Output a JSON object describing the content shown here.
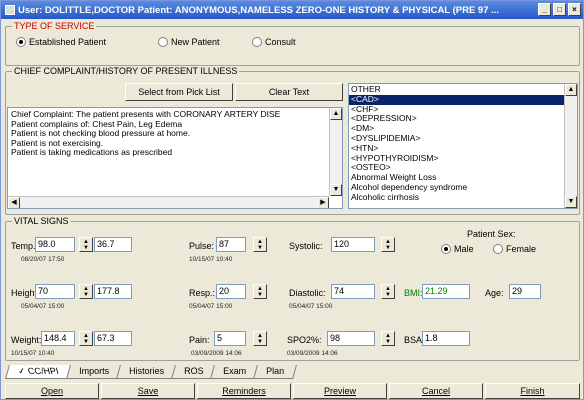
{
  "window": {
    "title": "User: DOLITTLE,DOCTOR Patient: ANONYMOUS,NAMELESS ZERO-ONE HISTORY & PHYSICAL (PRE 97 ..."
  },
  "service": {
    "group_title": "TYPE OF SERVICE",
    "options": [
      {
        "label": "Established Patient",
        "selected": true
      },
      {
        "label": "New Patient",
        "selected": false
      },
      {
        "label": "Consult",
        "selected": false
      }
    ]
  },
  "complaint": {
    "group_title": "CHIEF COMPLAINT/HISTORY OF PRESENT ILLNESS",
    "pick_button": "Select from Pick List",
    "clear_button": "Clear Text",
    "text_lines": [
      "Chief Complaint: The patient presents with CORONARY ARTERY DISE",
      "Patient complains of: Chest Pain, Leg Edema",
      "Patient is not checking blood pressure at home.",
      "Patient is not exercising.",
      "Patient is taking medications as prescribed"
    ],
    "pick_list": [
      "OTHER",
      "<CAD>",
      "<CHF>",
      "<DEPRESSION>",
      "<DM>",
      "<DYSLIPIDEMIA>",
      "<HTN>",
      "<HYPOTHYROIDISM>",
      "<OSTEO>",
      "Abnormal Weight Loss",
      "Alcohol dependency syndrome",
      "Alcoholic cirrhosis"
    ],
    "selected_index": 1
  },
  "vitals": {
    "group_title": "VITAL SIGNS",
    "temp": {
      "label": "Temp.:",
      "value": "98.0",
      "value2": "36.7",
      "date": "08/20/07 17:50"
    },
    "pulse": {
      "label": "Pulse:",
      "value": "87",
      "date": "10/15/07 10:40"
    },
    "systolic": {
      "label": "Systolic:",
      "value": "120"
    },
    "height": {
      "label": "Height:",
      "value": "70",
      "value2": "177.8",
      "date": "05/04/07 15:00"
    },
    "resp": {
      "label": "Resp.:",
      "value": "20",
      "date": "05/04/07 15:00"
    },
    "diastolic": {
      "label": "Diastolic:",
      "value": "74",
      "date": "05/04/07 15:00"
    },
    "bmi": {
      "label": "BMI:",
      "value": "21.29",
      "color": "#008000"
    },
    "age": {
      "label": "Age:",
      "value": "29"
    },
    "weight": {
      "label": "Weight:",
      "value": "148.4",
      "value2": "67.3",
      "date": "10/15/07 10:40"
    },
    "pain": {
      "label": "Pain:",
      "value": "5",
      "date": "03/09/2009 14:06"
    },
    "spo2": {
      "label": "SPO2%:",
      "value": "98",
      "date": "03/09/2009 14:06"
    },
    "bsa": {
      "label": "BSA:",
      "value": "1.8"
    },
    "sex": {
      "label": "Patient Sex:",
      "male": "Male",
      "female": "Female",
      "selected": "Male"
    }
  },
  "tabs": [
    "CC/HPI",
    "Imports",
    "Histories",
    "ROS",
    "Exam",
    "Plan"
  ],
  "buttons": [
    "Open",
    "Save",
    "Reminders",
    "Preview",
    "Cancel",
    "Finish"
  ]
}
